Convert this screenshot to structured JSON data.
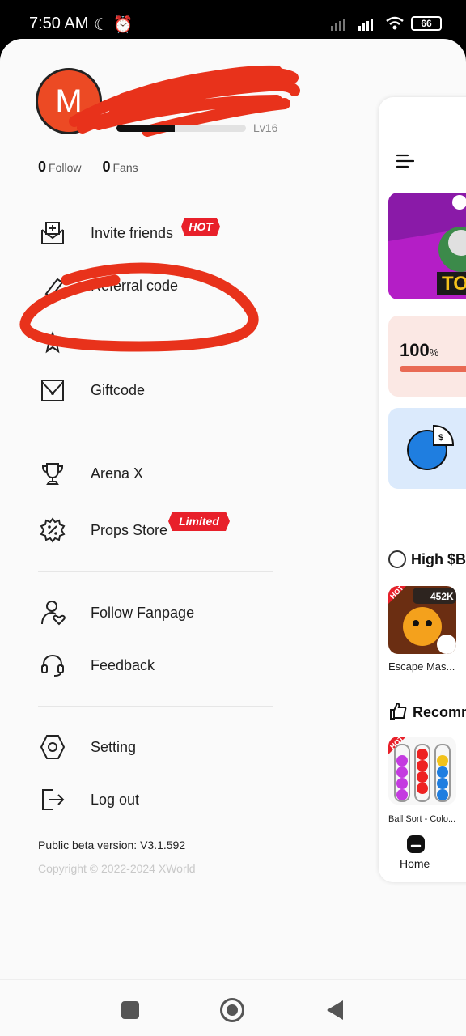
{
  "status_bar": {
    "time": "7:50 AM",
    "moon_glyph": "☾",
    "alarm_glyph": "⏰",
    "battery": "66"
  },
  "profile": {
    "avatar_letter": "M",
    "level_label": "Lv16",
    "level_progress": 0.45,
    "follow_count": "0",
    "follow_label": "Follow",
    "fans_count": "0",
    "fans_label": "Fans"
  },
  "menu": {
    "invite_friends": "Invite friends",
    "hot_badge": "HOT",
    "referral_code": "Referral code",
    "giftcode": "Giftcode",
    "arena_x": "Arena X",
    "props_store": "Props Store",
    "limited_badge": "Limited",
    "follow_fanpage": "Follow Fanpage",
    "feedback": "Feedback",
    "setting": "Setting",
    "log_out": "Log out"
  },
  "footer": {
    "version": "Public beta version: V3.1.592",
    "copyright": "Copyright © 2022-2024 XWorld"
  },
  "peek": {
    "progress_value": "100",
    "progress_unit": "%",
    "section_high": "High $B",
    "game1_views": "452K",
    "game1_badge": "HOT",
    "game1_name": "Escape Mas...",
    "section_recommend": "Recomm",
    "game2_badge": "HOT",
    "game2_name": "Ball Sort - Colo...",
    "nav_home": "Home"
  },
  "colors": {
    "accent_red": "#e8321b",
    "avatar_orange": "#ec4a24",
    "badge_red": "#e8202a"
  }
}
